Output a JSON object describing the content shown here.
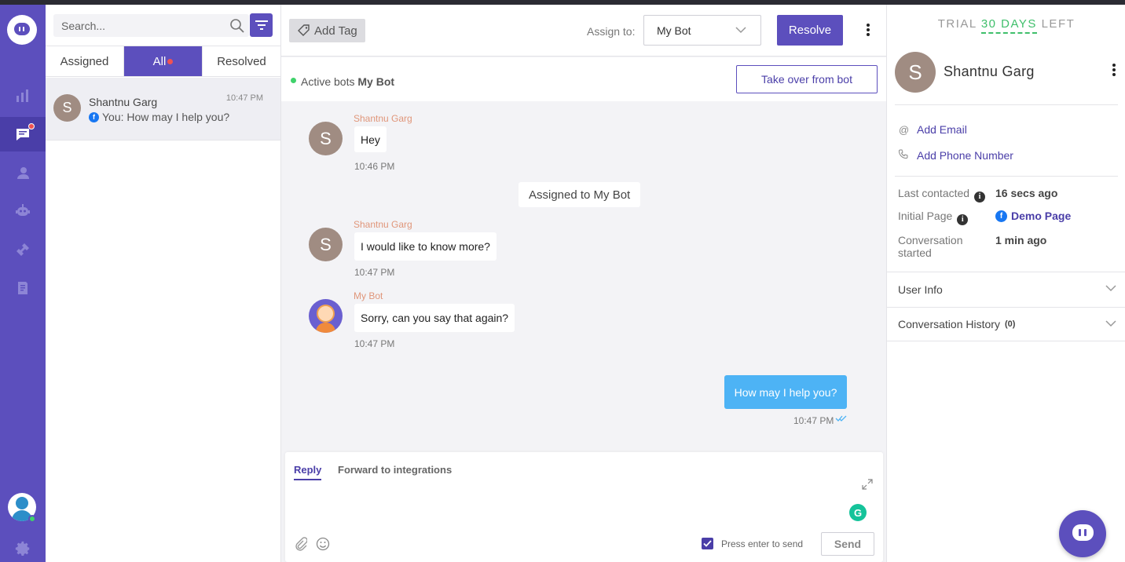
{
  "sidebar_nav": {
    "items": [
      "reports-icon",
      "conversations-icon",
      "users-icon",
      "bot-icon",
      "integrations-icon",
      "knowledge-base-icon"
    ],
    "settings": "gear-icon"
  },
  "list": {
    "search_placeholder": "Search...",
    "tabs": [
      {
        "label": "Assigned"
      },
      {
        "label": "All"
      },
      {
        "label": "Resolved"
      }
    ],
    "conversation": {
      "avatar_letter": "S",
      "name": "Shantnu Garg",
      "time": "10:47 PM",
      "preview": "You: How may I help you?"
    }
  },
  "topbar": {
    "add_tag": "Add Tag",
    "assign_label": "Assign to:",
    "assign_value": "My Bot",
    "resolve": "Resolve"
  },
  "botbar": {
    "label": "Active bots",
    "bot_name": "My Bot",
    "takeover": "Take over from bot"
  },
  "messages": [
    {
      "sender": "Shantnu Garg",
      "avatar": "S",
      "text": "Hey",
      "time": "10:46 PM"
    },
    {
      "system": "Assigned to My Bot"
    },
    {
      "sender": "Shantnu Garg",
      "avatar": "S",
      "text": "I would like to know more?",
      "time": "10:47 PM"
    },
    {
      "sender": "My Bot",
      "text": "Sorry, can you say that again?",
      "time": "10:47 PM"
    },
    {
      "outgoing": true,
      "text": "How may I help you?",
      "time": "10:47 PM"
    }
  ],
  "composer": {
    "tab_reply": "Reply",
    "tab_forward": "Forward to integrations",
    "grammarly": "G",
    "enter_label": "Press enter to send",
    "send": "Send"
  },
  "right": {
    "trial_prefix": "TRIAL",
    "trial_days": "30 DAYS",
    "trial_suffix": "LEFT",
    "avatar": "S",
    "name": "Shantnu Garg",
    "add_email": "Add Email",
    "add_phone": "Add Phone Number",
    "last_contacted_key": "Last contacted",
    "last_contacted_val": "16 secs ago",
    "initial_page_key": "Initial Page",
    "initial_page_val": "Demo Page",
    "conv_started_key_1": "Conversation",
    "conv_started_key_2": "started",
    "conv_started_val": "1 min ago",
    "user_info": "User Info",
    "conv_history": "Conversation History",
    "conv_history_count": "(0)"
  },
  "colors": {
    "brand": "#5c4fbd",
    "outgoing_bubble": "#4db3f5",
    "trial_green": "#3fbf6b",
    "sender_name": "#e0967a"
  }
}
